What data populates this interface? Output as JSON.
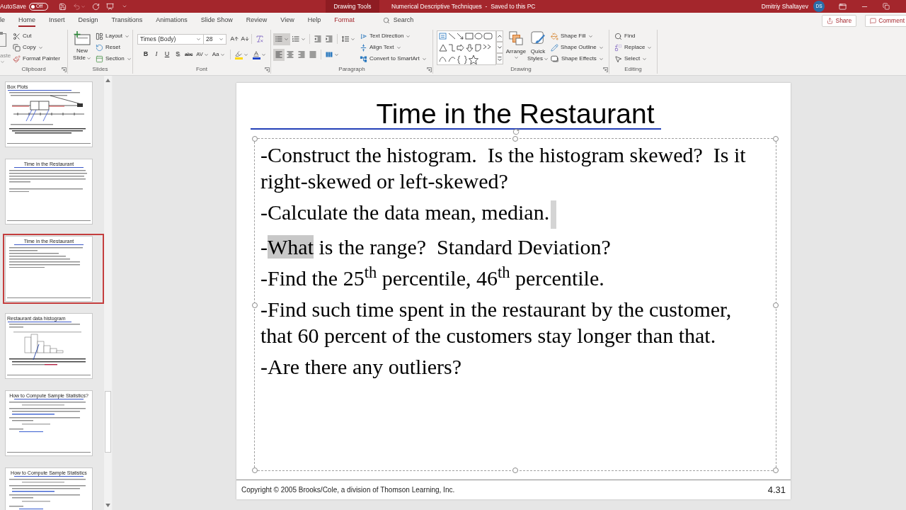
{
  "title_bar": {
    "autosave_label": "AutoSave",
    "autosave": {
      "label": "Off",
      "on": false
    },
    "undo": {
      "disabled": true
    },
    "context_group": "Drawing Tools",
    "document_title": "Numerical Descriptive Techniques  -  Saved to this PC",
    "user_name": "Dmitriy Shaltayev",
    "user_initials": "DS"
  },
  "ribbon_tabs": [
    {
      "label": "le",
      "kind": "tab",
      "selected": false
    },
    {
      "label": "Home",
      "kind": "tab",
      "selected": true
    },
    {
      "label": "Insert",
      "kind": "tab",
      "selected": false
    },
    {
      "label": "Design",
      "kind": "tab",
      "selected": false
    },
    {
      "label": "Transitions",
      "kind": "tab",
      "selected": false
    },
    {
      "label": "Animations",
      "kind": "tab",
      "selected": false
    },
    {
      "label": "Slide Show",
      "kind": "tab",
      "selected": false
    },
    {
      "label": "Review",
      "kind": "tab",
      "selected": false
    },
    {
      "label": "View",
      "kind": "tab",
      "selected": false
    },
    {
      "label": "Help",
      "kind": "tab",
      "selected": false
    },
    {
      "label": "Format",
      "kind": "contextual",
      "selected": false
    }
  ],
  "search": {
    "placeholder": "Search"
  },
  "share_button": "Share",
  "comments_button": "Comment",
  "clipboard": {
    "label": "Clipboard",
    "paste": {
      "label": "aste",
      "disabled": true
    },
    "buttons": [
      {
        "kind": "cut",
        "label": "Cut",
        "dropdown": false
      },
      {
        "kind": "copy",
        "label": "Copy",
        "dropdown": true
      },
      {
        "kind": "format_painter",
        "label": "Format Painter",
        "dropdown": false
      }
    ]
  },
  "slides": {
    "label": "Slides",
    "new_slide": {
      "lines": [
        "New",
        "Slide"
      ]
    },
    "buttons": [
      {
        "kind": "layout",
        "label": "Layout",
        "dropdown": true
      },
      {
        "kind": "reset",
        "label": "Reset",
        "dropdown": false
      },
      {
        "kind": "section",
        "label": "Section",
        "dropdown": true
      }
    ]
  },
  "font": {
    "label": "Font",
    "font_name": "Times (Body)",
    "font_size": "28",
    "style_buttons": [
      {
        "kind": "bold",
        "label": "B",
        "dropdown": false
      },
      {
        "kind": "italic",
        "label": "I",
        "dropdown": false
      },
      {
        "kind": "underline",
        "label": "U",
        "dropdown": false
      },
      {
        "kind": "shadow",
        "label": "S",
        "dropdown": false
      },
      {
        "kind": "strikethrough",
        "label": "abc",
        "dropdown": false
      },
      {
        "kind": "spacing",
        "label": "AV",
        "dropdown": true
      },
      {
        "kind": "case",
        "label": "Aa",
        "dropdown": true
      }
    ]
  },
  "paragraph": {
    "label": "Paragraph",
    "list_buttons": [
      {
        "kind": "bullets",
        "selected": true,
        "dropdown": true
      },
      {
        "kind": "numbering",
        "selected": false,
        "dropdown": true
      },
      {
        "kind": "decrease_indent",
        "selected": false,
        "dropdown": false
      },
      {
        "kind": "increase_indent",
        "selected": false,
        "dropdown": false
      },
      {
        "kind": "line_spacing",
        "selected": false,
        "dropdown": true
      }
    ],
    "align_buttons": [
      {
        "kind": "left",
        "selected": true,
        "dropdown": false
      },
      {
        "kind": "center",
        "selected": false,
        "dropdown": false
      },
      {
        "kind": "right",
        "selected": false,
        "dropdown": false
      },
      {
        "kind": "justify",
        "selected": false,
        "dropdown": false
      },
      {
        "kind": "columns",
        "selected": false,
        "dropdown": true
      }
    ],
    "text_buttons": [
      {
        "kind": "text_direction",
        "label": "Text Direction",
        "dropdown": true
      },
      {
        "kind": "align_text",
        "label": "Align Text",
        "dropdown": true
      },
      {
        "kind": "smartart",
        "label": "Convert to SmartArt",
        "dropdown": true
      }
    ]
  },
  "drawing": {
    "label": "Drawing",
    "arrange": {
      "label": "Arrange"
    },
    "quick_styles": {
      "lines": [
        "Quick",
        "Styles"
      ]
    },
    "buttons": [
      {
        "kind": "fill",
        "label": "Shape Fill",
        "dropdown": true
      },
      {
        "kind": "outline",
        "label": "Shape Outline",
        "dropdown": true
      },
      {
        "kind": "effects",
        "label": "Shape Effects",
        "dropdown": true
      }
    ]
  },
  "editing": {
    "label": "Editing",
    "buttons": [
      {
        "kind": "find",
        "label": "Find",
        "dropdown": false
      },
      {
        "kind": "replace",
        "label": "Replace",
        "dropdown": true
      },
      {
        "kind": "select",
        "label": "Select",
        "dropdown": true
      }
    ]
  },
  "thumbnails": [
    {
      "title": "Box Plots",
      "kind": "diagram",
      "selected": false
    },
    {
      "title": "Time in the Restaurant",
      "kind": "text",
      "selected": false
    },
    {
      "title": "Time in the Restaurant",
      "kind": "bullets",
      "selected": true
    },
    {
      "title": "Restaurant data histogram",
      "kind": "chart",
      "selected": false
    },
    {
      "title": "How to Compute Sample Statistics?",
      "kind": "code",
      "selected": false
    },
    {
      "title": "How to Compute Sample Statistics",
      "kind": "code",
      "selected": false
    }
  ],
  "slide": {
    "title": "Time in the Restaurant",
    "bullets": [
      {
        "caret": false,
        "parts": [
          {
            "text": "-Construct the histogram.  Is the histogram skewed?  Is it right-skewed or left-skewed?",
            "selected": false
          }
        ]
      },
      {
        "caret": true,
        "parts": [
          {
            "text": "-Calculate the data mean, median.",
            "selected": false
          }
        ]
      },
      {
        "caret": false,
        "parts": [
          {
            "text": "-",
            "selected": false
          },
          {
            "text": "What",
            "selected": true
          },
          {
            "text": " is the range?  Standard Deviation?",
            "selected": false
          }
        ]
      },
      {
        "caret": false,
        "parts": [
          {
            "text": "-Find the 25$^{th}$ percentile, 46$^{th}$ percentile.",
            "selected": false
          }
        ]
      },
      {
        "caret": false,
        "parts": [
          {
            "text": "-Find such time spent in the restaurant by the customer, that 60 percent of the customers stay longer than that.",
            "selected": false
          }
        ]
      },
      {
        "caret": false,
        "parts": [
          {
            "text": "-Are there any outliers?",
            "selected": false
          }
        ]
      }
    ],
    "footer": "Copyright © 2005 Brooks/Cole, a division of Thomson Learning, Inc.",
    "slide_number": "4.31"
  }
}
